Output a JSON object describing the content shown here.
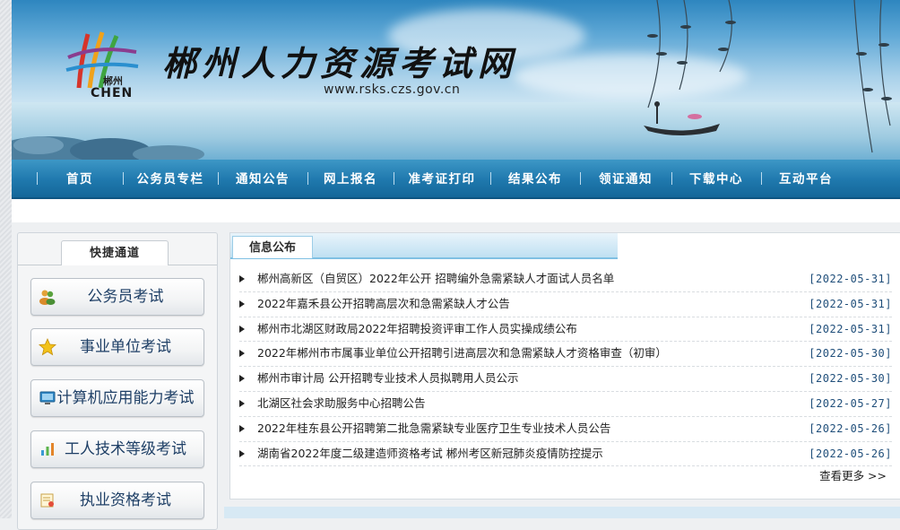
{
  "header": {
    "site_title": "郴州人力资源考试网",
    "site_url": "www.rsks.czs.gov.cn",
    "logo_text_cn": "郴州",
    "logo_text_en": "CHEN"
  },
  "nav": {
    "items": [
      "首页",
      "公务员专栏",
      "通知公告",
      "网上报名",
      "准考证打印",
      "结果公布",
      "领证通知",
      "下载中心",
      "互动平台"
    ]
  },
  "sidebar": {
    "tab_label": "快捷通道",
    "buttons": [
      {
        "label": "公务员考试",
        "icon": "people-icon"
      },
      {
        "label": "事业单位考试",
        "icon": "star-icon"
      },
      {
        "label": "计算机应用能力考试",
        "icon": "monitor-icon"
      },
      {
        "label": "工人技术等级考试",
        "icon": "chart-icon"
      },
      {
        "label": "执业资格考试",
        "icon": "certificate-icon"
      }
    ]
  },
  "info": {
    "tab_label": "信息公布",
    "more_label": "查看更多 >>",
    "items": [
      {
        "title": "郴州高新区（自贸区）2022年公开 招聘编外急需紧缺人才面试人员名单",
        "date": "[2022-05-31]"
      },
      {
        "title": "2022年嘉禾县公开招聘高层次和急需紧缺人才公告",
        "date": "[2022-05-31]"
      },
      {
        "title": "郴州市北湖区财政局2022年招聘投资评审工作人员实操成绩公布",
        "date": "[2022-05-31]"
      },
      {
        "title": "2022年郴州市市属事业单位公开招聘引进高层次和急需紧缺人才资格审查（初审）",
        "date": "[2022-05-30]"
      },
      {
        "title": "郴州市审计局 公开招聘专业技术人员拟聘用人员公示",
        "date": "[2022-05-30]"
      },
      {
        "title": "北湖区社会求助服务中心招聘公告",
        "date": "[2022-05-27]"
      },
      {
        "title": "2022年桂东县公开招聘第二批急需紧缺专业医疗卫生专业技术人员公告",
        "date": "[2022-05-26]"
      },
      {
        "title": "湖南省2022年度二级建造师资格考试 郴州考区新冠肺炎疫情防控提示",
        "date": "[2022-05-26]"
      }
    ]
  },
  "colors": {
    "nav_bg": "#1f78ad",
    "date_text": "#1f4e7a",
    "button_text": "#1e3f66"
  }
}
